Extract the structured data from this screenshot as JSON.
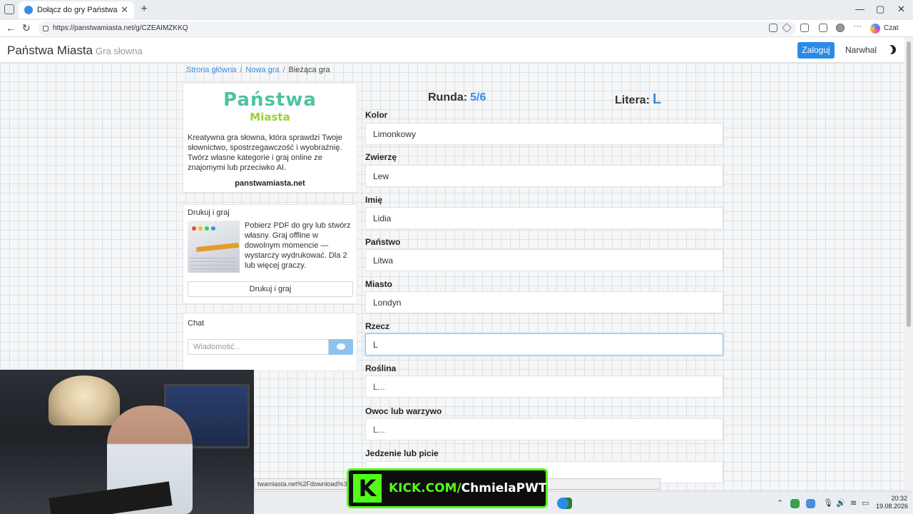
{
  "browser": {
    "tab_title": "Dołącz do gry Państwa Miasta",
    "tab_close": "✕",
    "new_tab": "+",
    "url": "https://panstwamiasta.net/g/CZEAIMZKKQ",
    "chat_label": "Czat",
    "minimize": "—",
    "maximize": "▢",
    "close": "✕"
  },
  "site": {
    "brand": "Państwa Miasta",
    "brand_sub": "Gra słowna",
    "login": "Zaloguj",
    "username": "Narwhal"
  },
  "breadcrumb": {
    "home": "Strona główna",
    "new_game": "Nowa gra",
    "current": "Bieżąca gra",
    "separator": "/"
  },
  "about": {
    "logo_line1": "Państwa",
    "logo_line2": "Miasta",
    "text": "Kreatywna gra słowna, która sprawdzi Twoje słownictwo, spostrzegawczość i wyobraźnię. Twórz własne kategorie i graj online ze znajomymi lub przeciwko AI.",
    "site": "panstwamiasta.net"
  },
  "print": {
    "title": "Drukuj i graj",
    "text": "Pobierz PDF do gry lub stwórz własny. Graj offline w dowolnym momencie — wystarczy wydrukować. Dla 2 lub więcej graczy.",
    "button": "Drukuj i graj"
  },
  "chat": {
    "title": "Chat",
    "placeholder": "Wiadomość..."
  },
  "game": {
    "round_label": "Runda:",
    "round_value": "5/6",
    "letter_label": "Litera:",
    "letter_value": "L",
    "fields": [
      {
        "label": "Kolor",
        "value": "Limonkowy",
        "placeholder": ""
      },
      {
        "label": "Zwierzę",
        "value": "Lew",
        "placeholder": ""
      },
      {
        "label": "Imię",
        "value": "Lidia",
        "placeholder": ""
      },
      {
        "label": "Państwo",
        "value": "Litwa",
        "placeholder": ""
      },
      {
        "label": "Miasto",
        "value": "Londyn",
        "placeholder": ""
      },
      {
        "label": "Rzecz",
        "value": "L",
        "placeholder": ""
      },
      {
        "label": "Roślina",
        "value": "",
        "placeholder": "L..."
      },
      {
        "label": "Owoc lub warzywo",
        "value": "",
        "placeholder": "L..."
      },
      {
        "label": "Jedzenie lub picie",
        "value": "",
        "placeholder": ""
      }
    ]
  },
  "status_url": "twamiasta.net%2Fdownload%3                                                                                      n_campaign%3DBANNER_MSG_BTN",
  "kick": {
    "logo": "K",
    "site": "KICK.COM/",
    "user": "ChmielaPWT"
  },
  "taskbar": {
    "time": "20:32",
    "date": "19.08.2026"
  }
}
